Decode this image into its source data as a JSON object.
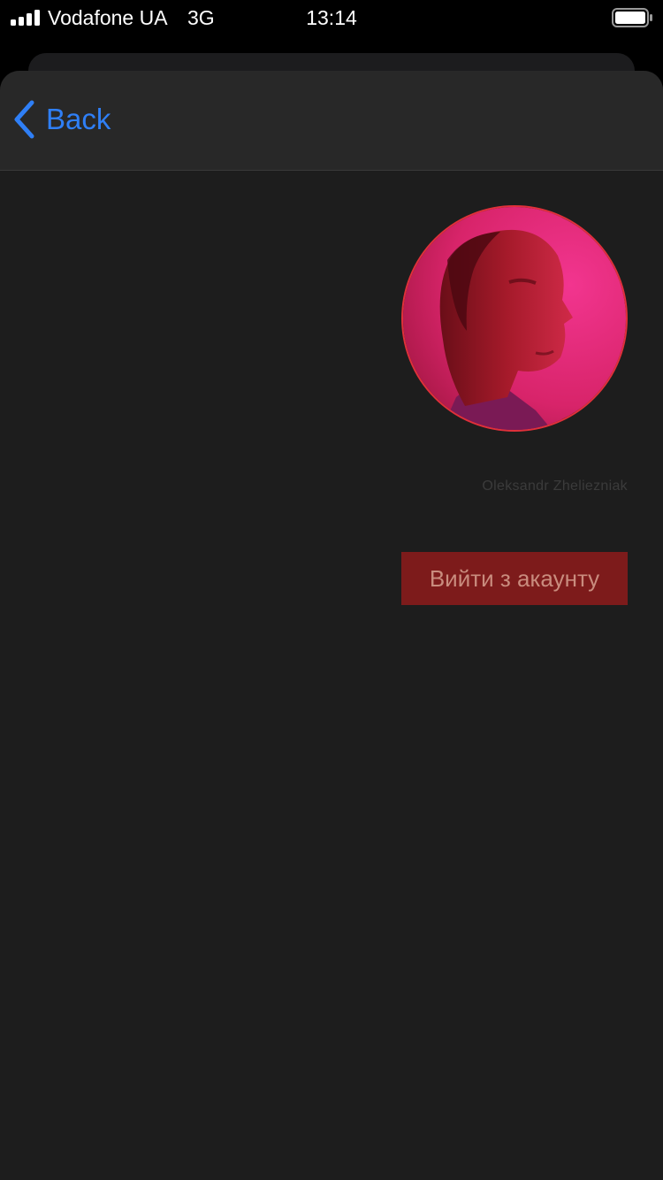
{
  "status_bar": {
    "carrier": "Vodafone UA",
    "network": "3G",
    "time": "13:14",
    "signal_icon": "signal-bars-icon",
    "battery_icon": "battery-icon"
  },
  "nav": {
    "back_label": "Back",
    "back_icon": "chevron-left-icon"
  },
  "profile": {
    "name": "Oleksandr Zheliezniak",
    "avatar": "user-avatar-photo"
  },
  "actions": {
    "logout_label": "Вийти з акаунту"
  },
  "colors": {
    "accent": "#2f7ff6",
    "logout_bg": "#7d1b1b",
    "logout_text": "#c98c7e",
    "avatar_border": "#e0303a"
  }
}
